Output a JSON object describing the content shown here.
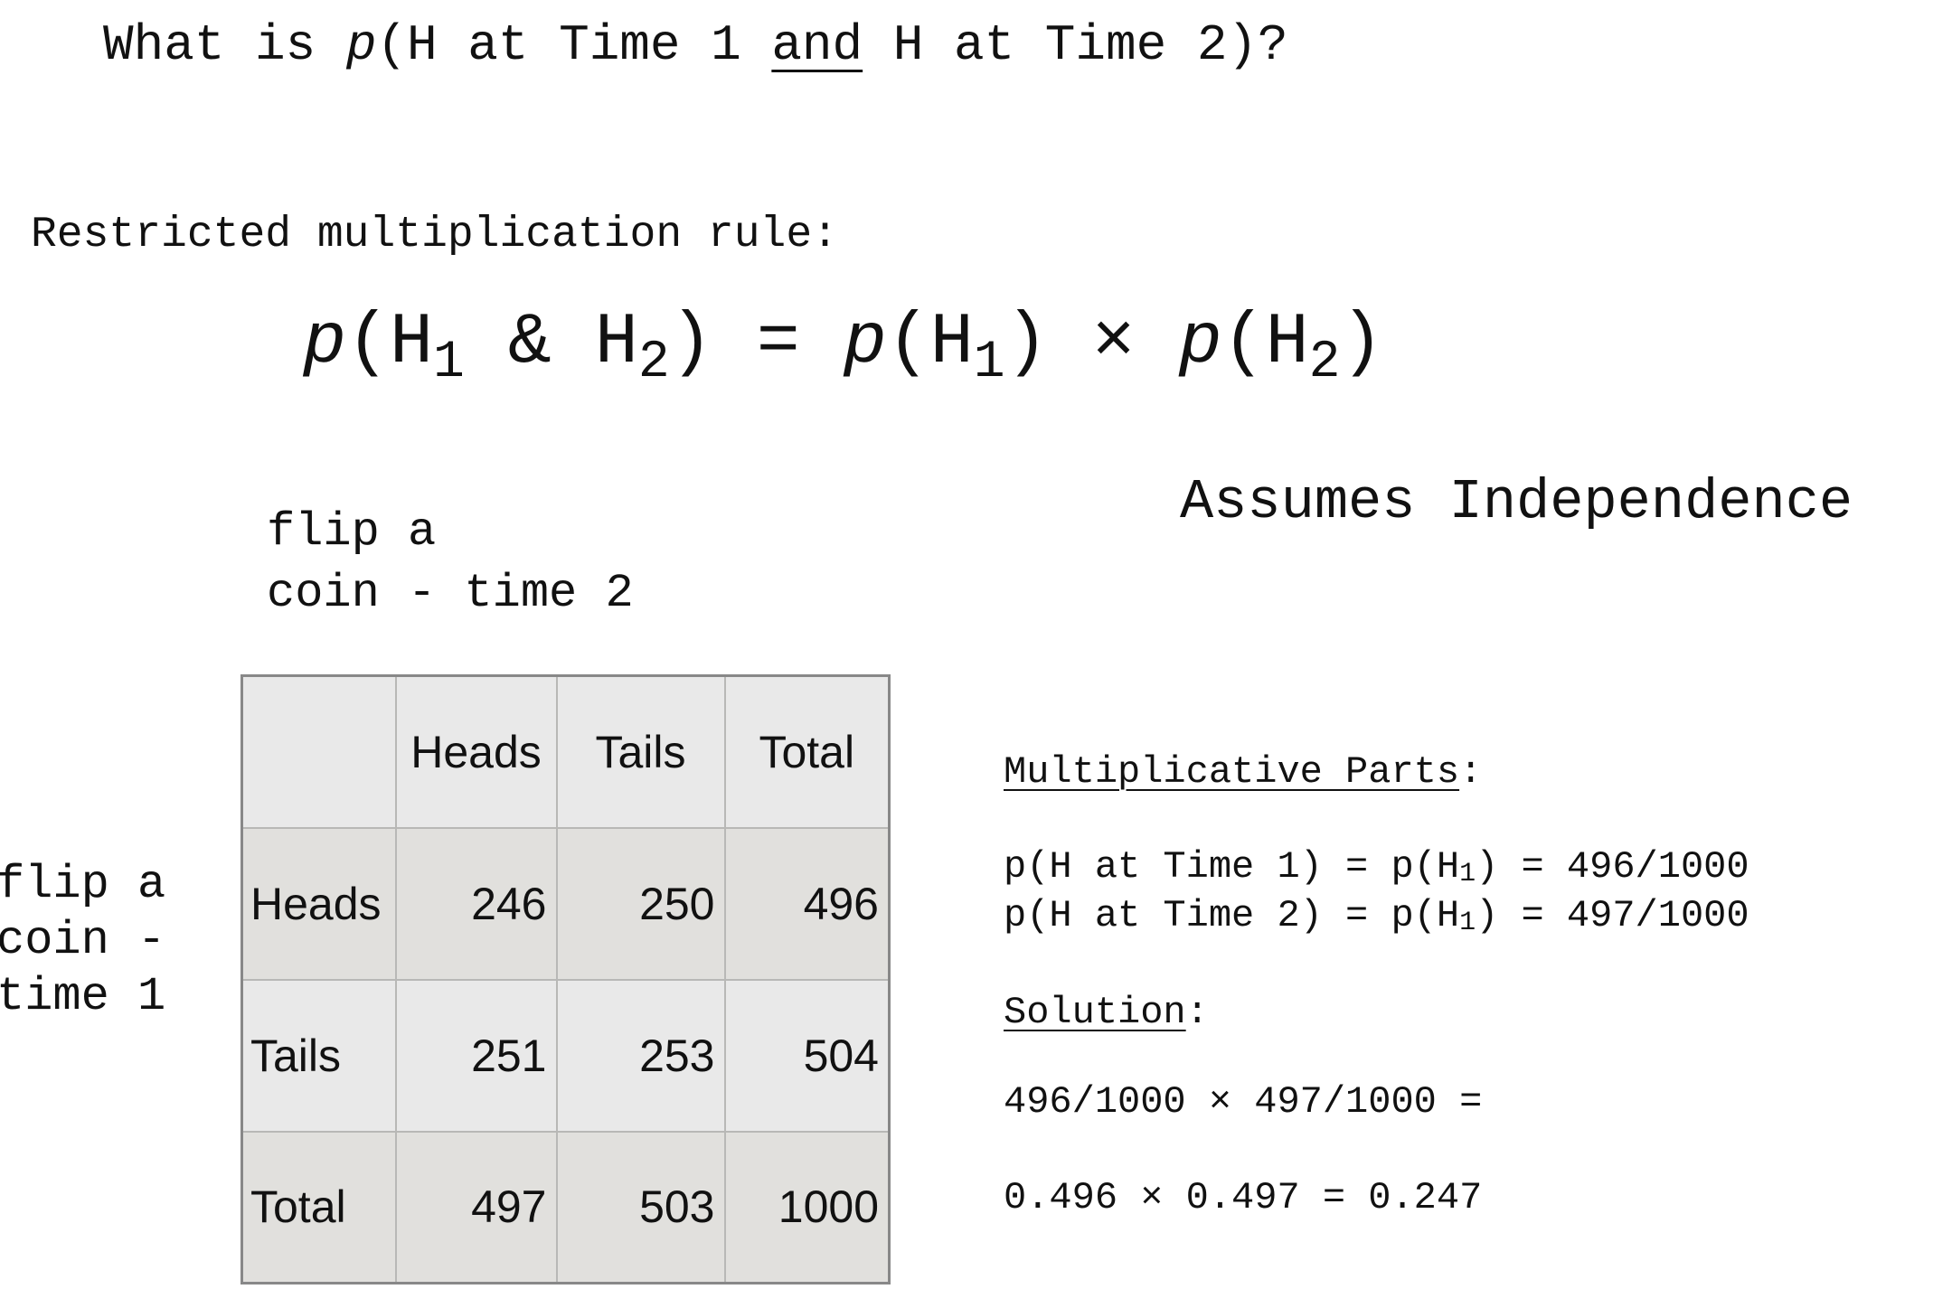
{
  "question": {
    "prefix": "What is ",
    "p": "p",
    "before": "(H at Time 1 ",
    "and": "and",
    "after": " H at Time 2)?"
  },
  "rule": {
    "label": "Restricted multiplication rule:",
    "formula": {
      "p": "p",
      "open": "(H",
      "sub1": "1",
      "amp": " & H",
      "sub2": "2",
      "close_eq": ") = ",
      "p2": "p",
      "open2": "(H",
      "sub3": "1",
      "times": ") × ",
      "p3": "p",
      "open3": "(H",
      "sub4": "2",
      "close": ")"
    }
  },
  "assumes": "Assumes Independence",
  "col_label": {
    "line1": "flip a",
    "line2": "coin - time 2"
  },
  "row_label": {
    "line1": "flip a",
    "line2": "coin -",
    "line3": "time 1"
  },
  "table": {
    "headers": [
      "",
      "Heads",
      "Tails",
      "Total"
    ],
    "rows": [
      {
        "label": "Heads",
        "values": [
          "246",
          "250",
          "496"
        ]
      },
      {
        "label": "Tails",
        "values": [
          "251",
          "253",
          "504"
        ]
      },
      {
        "label": "Total",
        "values": [
          "497",
          "503",
          "1000"
        ]
      }
    ]
  },
  "multiplicative": {
    "heading": "Multiplicative Parts",
    "colon": ":",
    "line1": {
      "a": "p(H at Time 1) = p(H",
      "sub": "1",
      "b": ") = 496/1000"
    },
    "line2": {
      "a": "p(H at Time 2) = p(H",
      "sub": "1",
      "b": ") = 497/1000"
    }
  },
  "solution": {
    "heading": "Solution",
    "colon": ":",
    "calc1": "496/1000 × 497/1000 =",
    "calc2": "0.496 × 0.497 = 0.247"
  }
}
